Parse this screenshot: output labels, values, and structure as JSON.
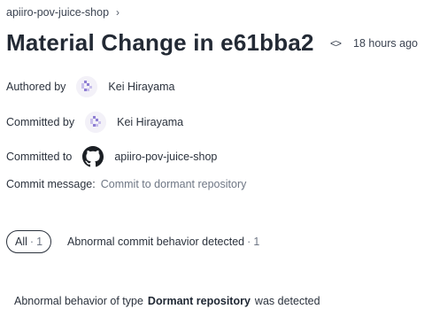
{
  "breadcrumb": {
    "repo": "apiiro-pov-juice-shop"
  },
  "header": {
    "title": "Material Change in e61bba2",
    "time_ago": "18 hours ago"
  },
  "authored": {
    "label": "Authored by",
    "name": "Kei Hirayama"
  },
  "committed": {
    "label": "Committed by",
    "name": "Kei Hirayama"
  },
  "committed_to": {
    "label": "Committed to",
    "repo": "apiiro-pov-juice-shop"
  },
  "commit_message": {
    "label": "Commit message:",
    "value": "Commit to dormant repository"
  },
  "tabs": [
    {
      "label": "All",
      "count": "1"
    },
    {
      "label": "Abnormal commit behavior detected",
      "count": "1"
    }
  ],
  "detail": {
    "prefix": "Abnormal behavior of type",
    "type": "Dormant repository",
    "suffix": "was detected"
  },
  "colors": {
    "avatar_purple": "#8f7fd3",
    "avatar_light": "#c9c0ec",
    "text": "#2b323d",
    "muted": "#6f7785"
  }
}
